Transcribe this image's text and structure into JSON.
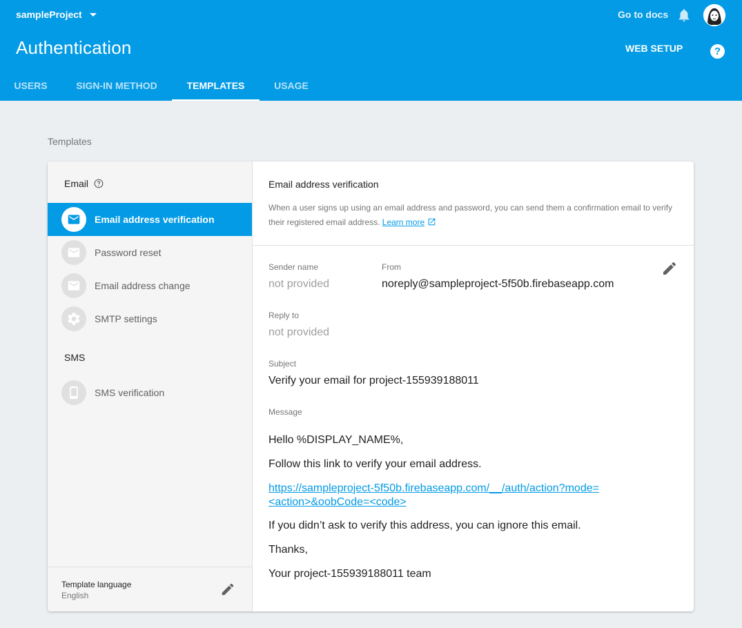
{
  "header": {
    "project_name": "sampleProject",
    "docs_label": "Go to docs",
    "page_title": "Authentication",
    "web_setup_label": "WEB SETUP",
    "help_symbol": "?"
  },
  "tabs": [
    {
      "label": "USERS",
      "active": false
    },
    {
      "label": "SIGN-IN METHOD",
      "active": false
    },
    {
      "label": "TEMPLATES",
      "active": true
    },
    {
      "label": "USAGE",
      "active": false
    }
  ],
  "section_label": "Templates",
  "sidebar": {
    "email_heading": "Email",
    "email_items": [
      {
        "label": "Email address verification",
        "icon": "mail-icon",
        "active": true
      },
      {
        "label": "Password reset",
        "icon": "mail-icon",
        "active": false
      },
      {
        "label": "Email address change",
        "icon": "mail-icon",
        "active": false
      },
      {
        "label": "SMTP settings",
        "icon": "gear-icon",
        "active": false
      }
    ],
    "sms_heading": "SMS",
    "sms_items": [
      {
        "label": "SMS verification",
        "icon": "phone-icon",
        "active": false
      }
    ],
    "template_language_label": "Template language",
    "template_language_value": "English"
  },
  "detail": {
    "title": "Email address verification",
    "description": "When a user signs up using an email address and password, you can send them a confirmation email to verify their registered email address.",
    "learn_more": "Learn more",
    "sender_name_label": "Sender name",
    "sender_name_value": "not provided",
    "from_label": "From",
    "from_value": "noreply@sampleproject-5f50b.firebaseapp.com",
    "reply_to_label": "Reply to",
    "reply_to_value": "not provided",
    "subject_label": "Subject",
    "subject_value": "Verify your email for project-155939188011",
    "message_label": "Message",
    "message": {
      "greeting": "Hello %DISPLAY_NAME%,",
      "instruction": "Follow this link to verify your email address.",
      "link": "https://sampleproject-5f50b.firebaseapp.com/__/auth/action?mode=<action>&oobCode=<code>",
      "ignore": "If you didn’t ask to verify this address, you can ignore this email.",
      "thanks": "Thanks,",
      "signature": "Your project-155939188011 team"
    }
  },
  "colors": {
    "brand": "#039be5",
    "background": "#eceff1",
    "sidebar": "#f5f5f5"
  }
}
